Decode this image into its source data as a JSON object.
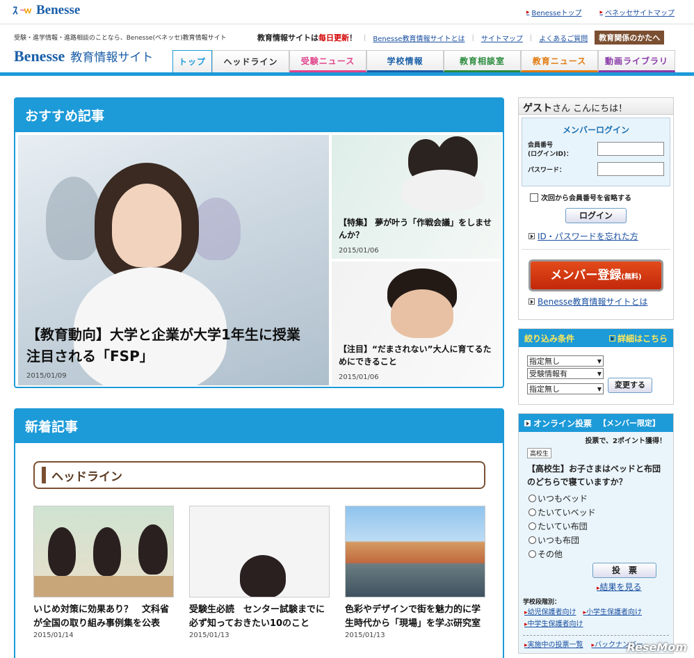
{
  "header": {
    "logo_text": "Benesse",
    "top_links": [
      "Benesseトップ",
      "ベネッセサイトマップ"
    ],
    "tagline": "受験・進学情報・進路相談のことなら、Benesse(ベネッセ)教育情報サイト",
    "update_prefix": "教育情報サイトは",
    "update_emph": "毎日更新",
    "update_suffix": "！",
    "sub_links": [
      "Benesse教育情報サイトとは",
      "サイトマップ",
      "よくあるご質問"
    ],
    "edu_button": "教育関係のかたへ",
    "site_brand": "Benesse",
    "site_name": "教育情報サイト"
  },
  "nav": {
    "tabs": [
      {
        "label": "トップ",
        "color": "#1d9ad8"
      },
      {
        "label": "ヘッドライン",
        "color": "#333333"
      },
      {
        "label": "受験ニュース",
        "color": "#e2448b"
      },
      {
        "label": "学校情報",
        "color": "#1a5fa8"
      },
      {
        "label": "教育相談室",
        "color": "#2a8a3c"
      },
      {
        "label": "教育ニュース",
        "color": "#e07a10"
      },
      {
        "label": "動画ライブラリ",
        "color": "#8a3aa8"
      }
    ]
  },
  "featured": {
    "heading": "おすすめ記事",
    "main": {
      "title": "【教育動向】大学と企業が大学1年生に授業　注目される「FSP」",
      "date": "2015/01/09"
    },
    "side": [
      {
        "title": "【特集】 夢が叶う「作戦会議」をしませんか？",
        "date": "2015/01/06"
      },
      {
        "title": "【注目】“だまされない”大人に育てるためにできること",
        "date": "2015/01/06"
      }
    ]
  },
  "news": {
    "heading": "新着記事",
    "section": "ヘッドライン",
    "cards": [
      {
        "title": "いじめ対策に効果あり？　文科省が全国の取り組み事例集を公表",
        "date": "2015/01/14"
      },
      {
        "title": "受験生必読　センター試験までに必ず知っておきたい10のこと",
        "date": "2015/01/13"
      },
      {
        "title": "色彩やデザインで街を魅力的に学生時代から「現場」を学ぶ研究室",
        "date": "2015/01/13"
      }
    ]
  },
  "sidebar": {
    "greeting_name": "ゲスト",
    "greeting_rest": "さん こんにちは！",
    "login_title": "メンバーログイン",
    "member_no_label": "会員番号",
    "login_id_label": "(ログインID)：",
    "password_label": "パスワード：",
    "remember_label": "次回から会員番号を省略する",
    "login_button": "ログイン",
    "forgot_link": "ID・パスワードを忘れた方",
    "register_button": "メンバー登録",
    "register_small": "(無料)",
    "about_link": "Benesse教育情報サイトとは",
    "filter_title": "絞り込み条件",
    "filter_detail": "詳細はこちら",
    "filter_selects": [
      "指定無し",
      "受験情報有",
      "指定無し"
    ],
    "filter_button": "変更する",
    "vote_title": "オンライン投票",
    "vote_limit": "【メンバー限定】",
    "vote_points": "投票で、2ポイント獲得！",
    "vote_badge": "高校生",
    "vote_question": "【高校生】お子さまはベッドと布団のどちらで寝ていますか？",
    "vote_options": [
      "いつもベッド",
      "たいていベッド",
      "たいてい布団",
      "いつも布団",
      "その他"
    ],
    "vote_button": "投　票",
    "vote_result_link": "結果を見る",
    "school_stage_label": "学校段階別：",
    "stage_links": [
      "幼児保護者向け",
      "小学生保護者向け",
      "中学生保護者向け"
    ],
    "bottom_links": [
      "実施中の投票一覧",
      "バックナンバー"
    ]
  },
  "watermark": "ReseMom"
}
